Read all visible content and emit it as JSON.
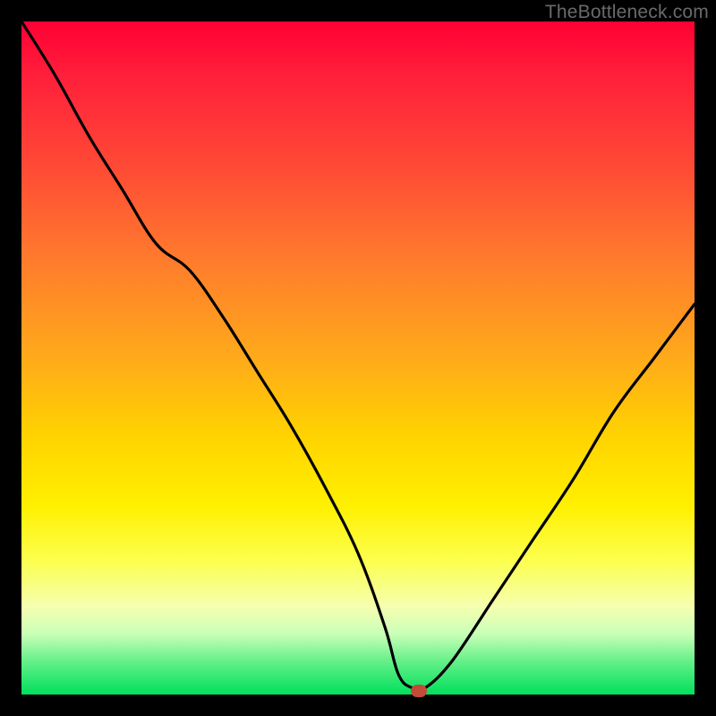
{
  "attribution": "TheBottleneck.com",
  "chart_data": {
    "type": "line",
    "title": "",
    "xlabel": "",
    "ylabel": "",
    "xlim": [
      0,
      100
    ],
    "ylim": [
      0,
      100
    ],
    "series": [
      {
        "name": "bottleneck-curve",
        "x": [
          0,
          5,
          10,
          15,
          20,
          25,
          30,
          35,
          40,
          45,
          50,
          54,
          56,
          58,
          60,
          64,
          70,
          76,
          82,
          88,
          94,
          100
        ],
        "y": [
          100,
          92,
          83,
          75,
          67,
          63,
          56,
          48,
          40,
          31,
          21,
          10,
          3,
          1,
          1,
          5,
          14,
          23,
          32,
          42,
          50,
          58
        ]
      }
    ],
    "marker": {
      "x": 59,
      "y": 0.5
    },
    "colors": {
      "curve": "#000000",
      "marker": "#c24a39",
      "gradient_stops": [
        "#ff0033",
        "#ff7d2c",
        "#ffd400",
        "#fcff4d",
        "#66f08a",
        "#00e05c"
      ]
    }
  }
}
